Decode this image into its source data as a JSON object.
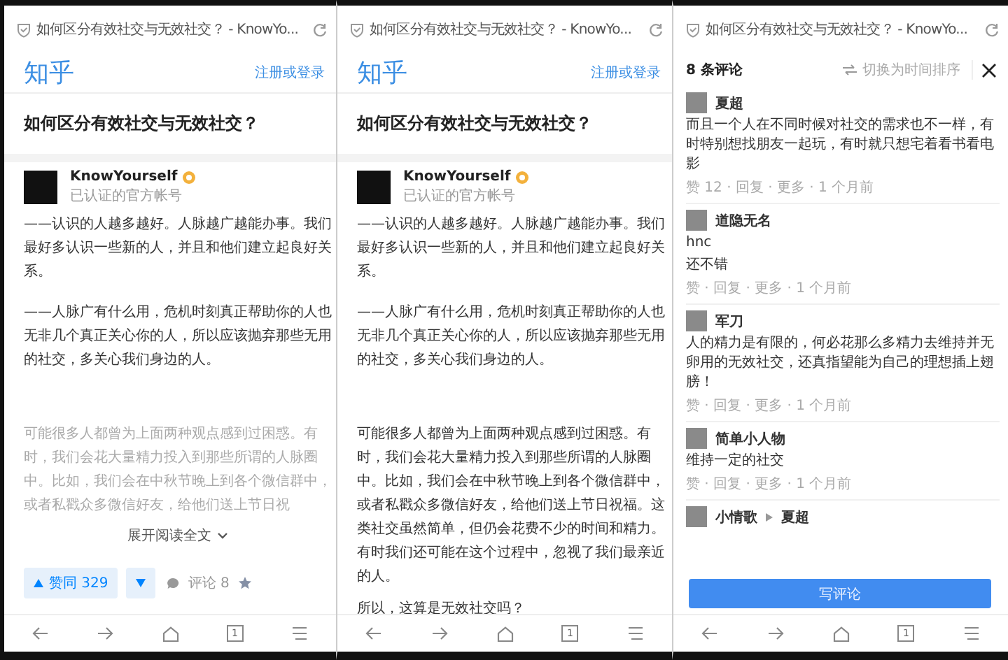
{
  "screens": [
    {
      "kind": "article",
      "browser_title": "如何区分有效社交与无效社交？ - KnowYo...",
      "logo": "知乎",
      "login": "注册或登录",
      "question": "如何区分有效社交与无效社交？",
      "author": {
        "name": "KnowYourself",
        "subtitle": "已认证的官方帐号"
      },
      "collapsed": true,
      "paragraphs": [
        "——认识的人越多越好。人脉越广越能办事。我们最好多认识一些新的人，并且和他们建立起良好关系。",
        "——人脉广有什么用，危机时刻真正帮助你的人也无非几个真正关心你的人，所以应该抛弃那些无用的社交，多关心我们身边的人。",
        "可能很多人都曾为上面两种观点感到过困惑。有时，我们会花大量精力投入到那些所谓的人脉圈中。比如，我们会在中秋节晚上到各个微信群中，或者私戳众多微信好友，给他们送上节日祝"
      ],
      "expand": "展开阅读全文",
      "vote": "赞同 329",
      "comment_count": "评论 8",
      "tab_count": "1"
    },
    {
      "kind": "article",
      "browser_title": "如何区分有效社交与无效社交？ - KnowYo...",
      "logo": "知乎",
      "login": "注册或登录",
      "question": "如何区分有效社交与无效社交？",
      "author": {
        "name": "KnowYourself",
        "subtitle": "已认证的官方帐号"
      },
      "collapsed": false,
      "paragraphs": [
        "——认识的人越多越好。人脉越广越能办事。我们最好多认识一些新的人，并且和他们建立起良好关系。",
        "——人脉广有什么用，危机时刻真正帮助你的人也无非几个真正关心你的人，所以应该抛弃那些无用的社交，多关心我们身边的人。",
        "可能很多人都曾为上面两种观点感到过困惑。有时，我们会花大量精力投入到那些所谓的人脉圈中。比如，我们会在中秋节晚上到各个微信群中，或者私戳众多微信好友，给他们送上节日祝福。这类社交虽然简单，但仍会花费不少的时间和精力。有时我们还可能在这个过程中，忽视了我们最亲近的人。",
        "所以，这算是无效社交吗？"
      ],
      "tab_count": "1"
    },
    {
      "kind": "comments",
      "browser_title": "如何区分有效社交与无效社交？ - KnowYo...",
      "heading": "8 条评论",
      "sort": "切换为时间排序",
      "comments": [
        {
          "author": "夏超",
          "lines": [
            "而且一个人在不同时候对社交的需求也不一样，有时特别想找朋友一起玩，有时就只想宅着看书看电影"
          ],
          "meta": "赞 12 · 回复 · 更多 · 1 个月前"
        },
        {
          "author": "道隐无名",
          "lines": [
            "hnc",
            "还不错"
          ],
          "meta": "赞 · 回复 · 更多 · 1 个月前"
        },
        {
          "author": "军刀",
          "lines": [
            "人的精力是有限的，何必花那么多精力去维持并无卵用的无效社交，还真指望能为自己的理想插上翅膀！"
          ],
          "meta": "赞 · 回复 · 更多 · 1 个月前"
        },
        {
          "author": "简单小人物",
          "lines": [
            "维持一定的社交"
          ],
          "meta": "赞 · 回复 · 更多 · 1 个月前"
        },
        {
          "author": "小情歌",
          "reply_to": "夏超"
        }
      ],
      "write": "写评论",
      "tab_count": "1"
    }
  ]
}
